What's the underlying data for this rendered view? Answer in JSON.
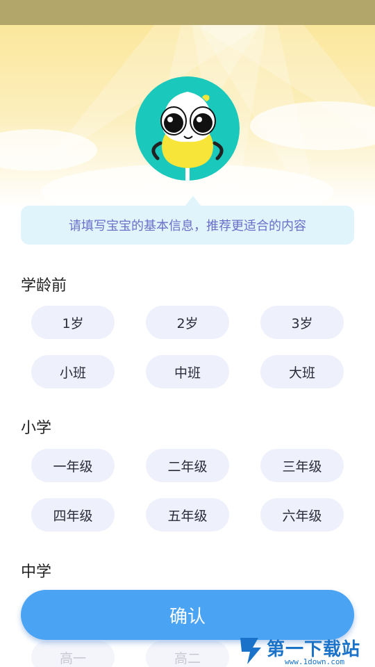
{
  "tip": {
    "text": "请填写宝宝的基本信息，推荐更适合的内容"
  },
  "sections": [
    {
      "title": "学龄前",
      "options": [
        "1岁",
        "2岁",
        "3岁",
        "小班",
        "中班",
        "大班"
      ]
    },
    {
      "title": "小学",
      "options": [
        "一年级",
        "二年级",
        "三年级",
        "四年级",
        "五年级",
        "六年级"
      ]
    },
    {
      "title": "中学",
      "options": [
        "高一",
        "高二"
      ]
    }
  ],
  "confirm_label": "确认",
  "watermark": {
    "text": "第一下载站",
    "url": "www.1down.com"
  },
  "colors": {
    "avatar_bg": "#1ac8bc",
    "tip_bg": "#dff4fb",
    "tip_text": "#6b6fc8",
    "option_bg": "#eef0fb",
    "confirm_bg": "#4aa3f3"
  }
}
